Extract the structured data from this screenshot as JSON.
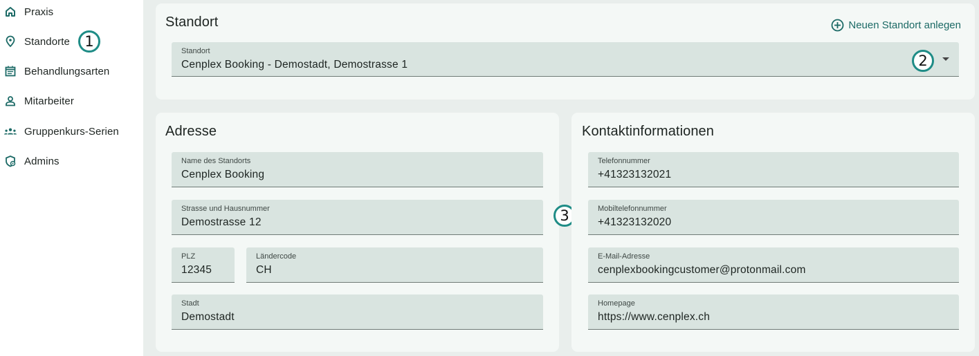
{
  "sidebar": {
    "items": [
      {
        "label": "Praxis",
        "icon": "home-icon"
      },
      {
        "label": "Standorte",
        "icon": "location-pin-icon"
      },
      {
        "label": "Behandlungsarten",
        "icon": "calendar-list-icon"
      },
      {
        "label": "Mitarbeiter",
        "icon": "person-icon"
      },
      {
        "label": "Gruppenkurs-Serien",
        "icon": "group-icon"
      },
      {
        "label": "Admins",
        "icon": "admin-shield-icon"
      }
    ]
  },
  "location_card": {
    "title": "Standort",
    "add_label": "Neuen Standort anlegen",
    "select": {
      "label": "Standort",
      "value": "Cenplex Booking - Demostadt, Demostrasse 1"
    }
  },
  "address_card": {
    "title": "Adresse",
    "fields": {
      "name": {
        "label": "Name des Standorts",
        "value": "Cenplex Booking"
      },
      "street": {
        "label": "Strasse und Hausnummer",
        "value": "Demostrasse 12"
      },
      "zip": {
        "label": "PLZ",
        "value": "12345"
      },
      "country": {
        "label": "Ländercode",
        "value": "CH"
      },
      "city": {
        "label": "Stadt",
        "value": "Demostadt"
      }
    }
  },
  "contact_card": {
    "title": "Kontaktinformationen",
    "fields": {
      "phone": {
        "label": "Telefonnummer",
        "value": "+41323132021"
      },
      "mobile": {
        "label": "Mobiltelefonnummer",
        "value": "+41323132020"
      },
      "email": {
        "label": "E-Mail-Adresse",
        "value": "cenplexbookingcustomer@protonmail.com"
      },
      "homepage": {
        "label": "Homepage",
        "value": "https://www.cenplex.ch"
      }
    }
  },
  "callouts": [
    "1",
    "2",
    "3"
  ],
  "colors": {
    "accent": "#1c6a66",
    "field_bg": "#d9e4e0",
    "card_bg": "#f4f8f6",
    "page_bg": "#e9eeec"
  }
}
